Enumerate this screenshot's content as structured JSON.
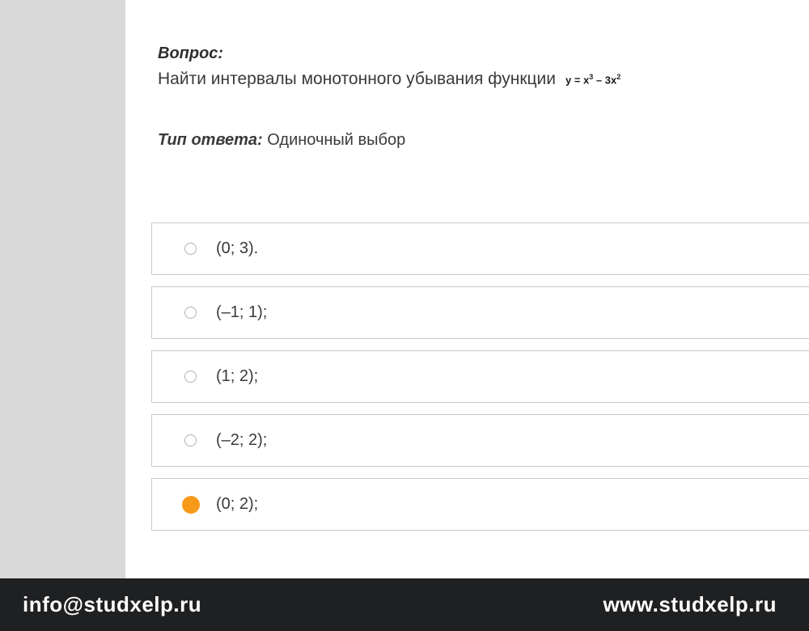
{
  "question": {
    "label": "Вопрос:",
    "text": "Найти интервалы монотонного убывания функции",
    "formula_html": "y = x<sup>3</sup> – 3x<sup>2</sup>"
  },
  "answer_type": {
    "label": "Тип ответа:",
    "value": "Одиночный выбор"
  },
  "options": [
    {
      "text": "(0; 3).",
      "selected": false
    },
    {
      "text": "(–1; 1);",
      "selected": false
    },
    {
      "text": "(1; 2);",
      "selected": false
    },
    {
      "text": "(–2; 2);",
      "selected": false
    },
    {
      "text": "(0; 2);",
      "selected": true
    }
  ],
  "footer": {
    "email": "info@studxelp.ru",
    "site": "www.studxelp.ru"
  }
}
